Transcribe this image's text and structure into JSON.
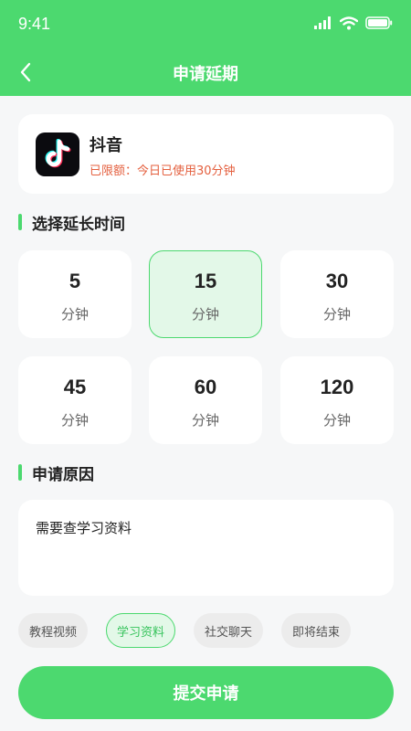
{
  "status_bar": {
    "time": "9:41"
  },
  "nav": {
    "title": "申请延期"
  },
  "app": {
    "name": "抖音",
    "limit_text": "已限额：今日已使用30分钟"
  },
  "sections": {
    "extend_time_title": "选择延长时间",
    "reason_title": "申请原因"
  },
  "time_options": [
    {
      "value": "5",
      "unit": "分钟",
      "selected": false
    },
    {
      "value": "15",
      "unit": "分钟",
      "selected": true
    },
    {
      "value": "30",
      "unit": "分钟",
      "selected": false
    },
    {
      "value": "45",
      "unit": "分钟",
      "selected": false
    },
    {
      "value": "60",
      "unit": "分钟",
      "selected": false
    },
    {
      "value": "120",
      "unit": "分钟",
      "selected": false
    }
  ],
  "reason": {
    "value": "需要查学习资料"
  },
  "reason_tags": [
    {
      "label": "教程视频",
      "selected": false
    },
    {
      "label": "学习资料",
      "selected": true
    },
    {
      "label": "社交聊天",
      "selected": false
    },
    {
      "label": "即将结束",
      "selected": false
    }
  ],
  "submit": {
    "label": "提交申请"
  },
  "colors": {
    "accent": "#4cd96f",
    "warning": "#e45f3e",
    "background": "#f6f7f8"
  },
  "icons": {
    "back": "chevron-left-icon",
    "signal": "signal-icon",
    "wifi": "wifi-icon",
    "battery": "battery-icon",
    "app": "tiktok-logo-icon"
  }
}
